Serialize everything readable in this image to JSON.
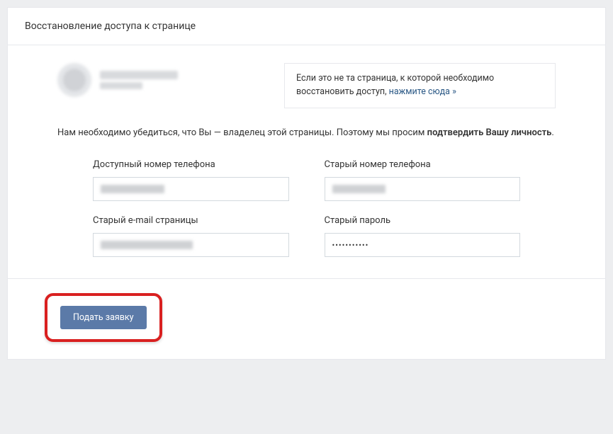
{
  "header": {
    "title": "Восстановление доступа к странице"
  },
  "notice": {
    "text_prefix": "Если это не та страница, к которой необходимо восстановить доступ, ",
    "link_text": "нажмите сюда »"
  },
  "instruction": {
    "text_before": "Нам необходимо убедиться, что Вы — владелец этой страницы. Поэтому мы просим ",
    "text_bold": "подтвердить Вашу личность",
    "text_after": "."
  },
  "form": {
    "available_phone": {
      "label": "Доступный номер телефона",
      "value": ""
    },
    "old_phone": {
      "label": "Старый номер телефона",
      "value": ""
    },
    "old_email": {
      "label": "Старый e-mail страницы",
      "value": ""
    },
    "old_password": {
      "label": "Старый пароль",
      "value": "•••••••••••"
    }
  },
  "footer": {
    "submit_label": "Подать заявку"
  }
}
